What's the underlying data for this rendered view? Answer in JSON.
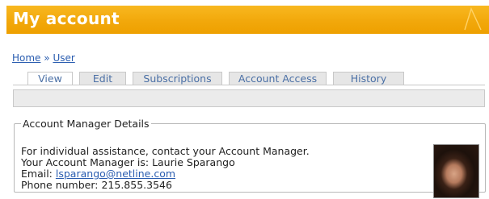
{
  "page": {
    "title": "My account"
  },
  "breadcrumb": {
    "home": "Home",
    "separator": "»",
    "user": "User"
  },
  "tabs": [
    "View",
    "Edit",
    "Subscriptions",
    "Account Access",
    "History"
  ],
  "active_tab": "View",
  "account_manager": {
    "legend": "Account Manager Details",
    "intro": "For individual assistance, contact your Account Manager.",
    "manager_prefix": "Your Account Manager is:",
    "manager_name": "Laurie Sparango",
    "email_label": "Email:",
    "email": "lsparango@netline.com",
    "phone_label": "Phone number:",
    "phone": "215.855.3546"
  },
  "colors": {
    "title_bar": "#f2a80b",
    "link": "#2a5db0",
    "subbar": "#ebebeb"
  }
}
